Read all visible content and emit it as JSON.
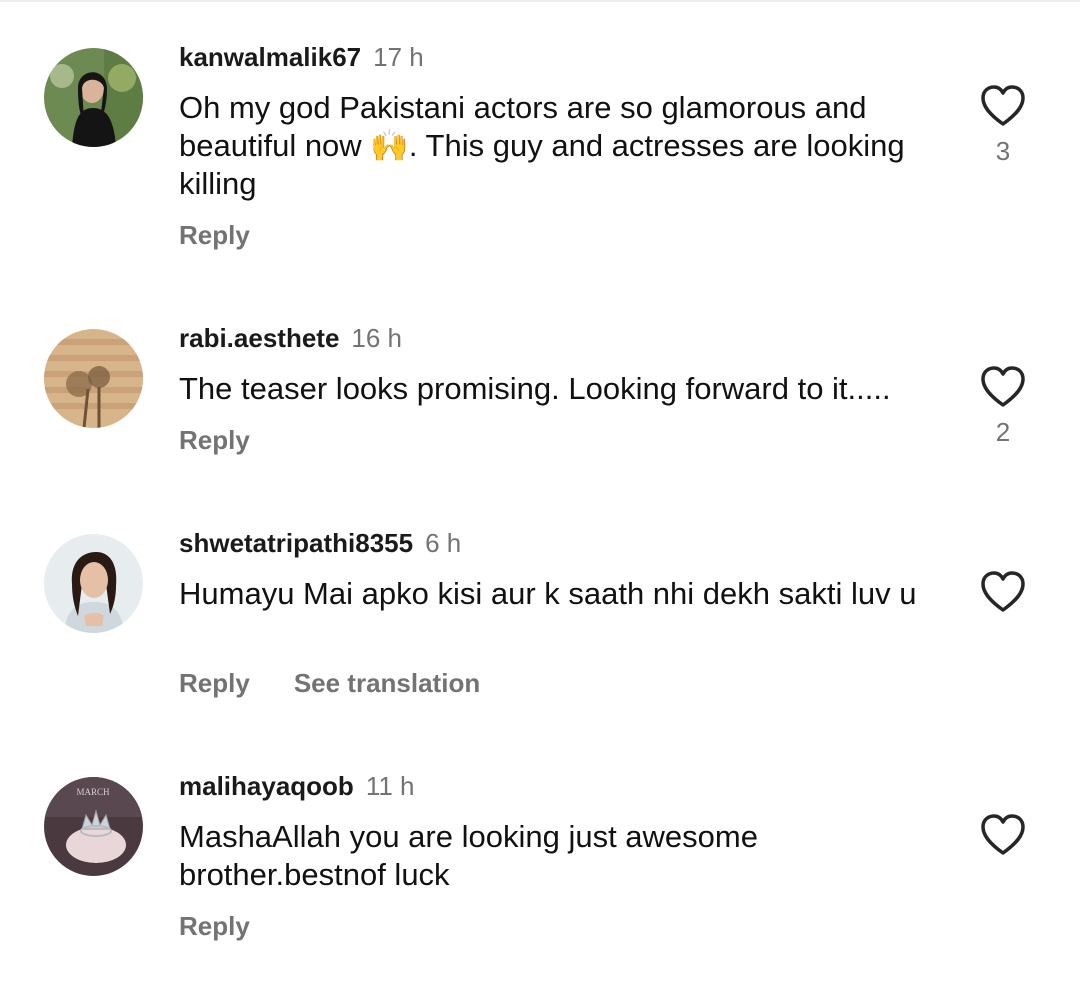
{
  "comments": [
    {
      "username": "kanwalmalik67",
      "time": "17 h",
      "text": "Oh my god Pakistani actors are so glamorous and beautiful now 🙌. This guy and actresses are looking killing",
      "reply": "Reply",
      "like_count": "3",
      "avatar_icon": "avatar-woman-plants"
    },
    {
      "username": "rabi.aesthete",
      "time": "16 h",
      "text": "The teaser looks promising. Looking forward to it.....",
      "reply": "Reply",
      "like_count": "2",
      "avatar_icon": "avatar-flowers-shadow"
    },
    {
      "username": "shwetatripathi8355",
      "time": "6 h",
      "text": "Humayu Mai apko kisi aur k saath nhi dekh sakti luv u",
      "reply": "Reply",
      "translation": "See translation",
      "like_count": "",
      "avatar_icon": "avatar-woman-portrait"
    },
    {
      "username": "malihayaqoob",
      "time": "11 h",
      "text": "MashaAllah you are looking just awesome brother.bestnof luck",
      "reply": "Reply",
      "like_count": "",
      "avatar_icon": "avatar-crown-ring",
      "avatar_text": "MARCH"
    }
  ],
  "colors": {
    "username": "#1a1a1a",
    "secondary_text": "#737373",
    "heart_outline": "#262626"
  }
}
